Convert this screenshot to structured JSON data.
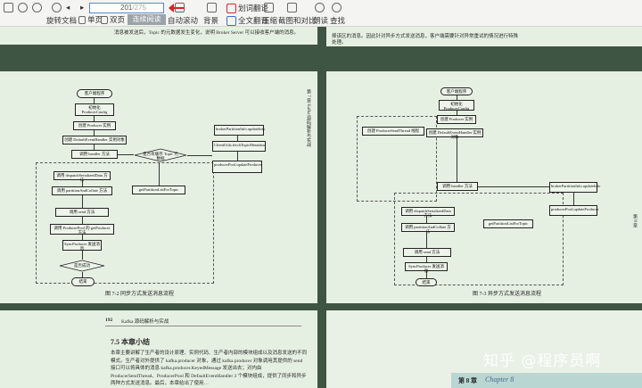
{
  "toolbar": {
    "rotate": "旋转文档",
    "single": "单页",
    "double": "双页",
    "continuous": "连续阅读",
    "autoscroll": "自动滚动",
    "background": "背景",
    "translate_full": "全文翻译",
    "translate_word": "划词翻译",
    "compress": "压缩",
    "screenshot": "截图和对比",
    "read": "朗读",
    "search": "查找",
    "page_current": "201",
    "page_total": "/275"
  },
  "left_page": {
    "top_text_1": "消息被发送后，Topic 的元数据发生变化，说明 Broker Server 可以接收客户端的消息。",
    "top_text_2": "",
    "figure_caption": "图 7-2   同步方式发送消息流程",
    "side_header": "第 7 章  Kafka 源码解析与实战",
    "bottom_page_number": "192",
    "bottom_header": "Kafka 源码解析与实战",
    "section_title": "7.5   本章小结",
    "para_1": "本章主要讲解了生产者的设计原理、实例代码、生产者内部的模块组成以及消息发送的不同模式。生产者对外提供了 kafka.producer 对象，通过 kafka.producer 对象调用其提供的 send 接口可以将具体的消息 kafka.producer.KeyedMessage 发送出去；对内由 ProducerSendThread、ProducerPool 和 DefaultEventHandler 3 个模块组成，提供了同步和异步两种方式发送消息。最后，本章给出了使用…"
  },
  "right_page": {
    "top_text_1": "择该区的消息。因此针对异步方式发送消息，客户端需要针对异常重试的情况进行特殊",
    "top_text_2": "处理。",
    "figure_caption": "图 7-3   异步方式发送消息流程",
    "side_header": "第 8 章",
    "chapter_label": "第 8 章",
    "chapter_script": "Chapter 8",
    "watermark": "知乎 @程序员啊"
  },
  "flow_left": {
    "start": "客户端程序",
    "n1": "初始化 ProducerConfig",
    "n2": "创建 Producer 实例",
    "n3": "创建 DefaultEventHandler 实例对象",
    "n4": "调用 handler 方法",
    "n5": "调用 dispatchSerializedData 方法",
    "n6": "调用 partitionAndCollate 方法",
    "n7": "调用 send 方法",
    "n8": "调用 ProducerPool 的 getProducer 方法",
    "n9": "SyncProducer 发送消息",
    "d1": "是否有缓存 Topic 元数据",
    "d2": "是否成功",
    "end": "结束",
    "r1": "brokerPartitionInfo.updateInfo",
    "r2": "ClientUtils.fetchTopicMetadata",
    "r3": "getPartitionListForTopic",
    "r4": "producerPool.updateProducer"
  },
  "flow_right": {
    "start": "客户端程序",
    "n1": "初始化 ProducerConfig",
    "n2": "创建 Producer 实例",
    "n3": "创建 DefaultEventHandler 实例对象",
    "n4": "创建 ProducerSendThread 线程",
    "n5": "调用 handler 方法",
    "n6": "调用 dispatchSerializedData 方法",
    "n7": "调用 partitionAndCollate 方法",
    "n8": "调用 send 方法",
    "n9": "SyncProducer 发送消息",
    "end": "结束",
    "r1": "brokerPartitionInfo.updateInfo",
    "r2": "getPartitionListForTopic",
    "r3": "producerPool.updateProducer"
  }
}
